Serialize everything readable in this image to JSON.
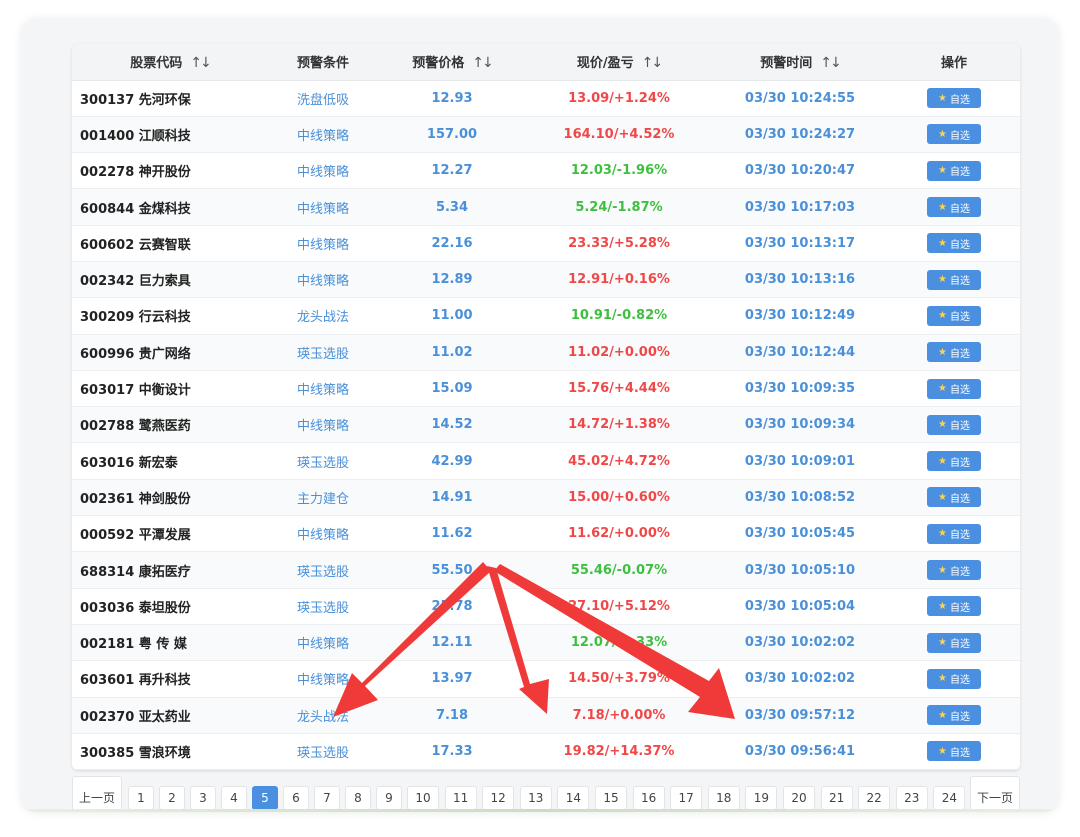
{
  "table": {
    "headers": {
      "code": "股票代码",
      "condition": "预警条件",
      "alert_price": "预警价格",
      "now_pl": "现价/盈亏",
      "alert_time": "预警时间",
      "action": "操作"
    },
    "sort_glyph": "↑↓",
    "button_label": "自选",
    "rows": [
      {
        "name": "300137 先河环保",
        "cond": "洗盘低吸",
        "price": "12.93",
        "now": "13.09/+1.24%",
        "dir": "up",
        "time": "03/30 10:24:55"
      },
      {
        "name": "001400 江顺科技",
        "cond": "中线策略",
        "price": "157.00",
        "now": "164.10/+4.52%",
        "dir": "up",
        "time": "03/30 10:24:27"
      },
      {
        "name": "002278 神开股份",
        "cond": "中线策略",
        "price": "12.27",
        "now": "12.03/-1.96%",
        "dir": "down",
        "time": "03/30 10:20:47"
      },
      {
        "name": "600844 金煤科技",
        "cond": "中线策略",
        "price": "5.34",
        "now": "5.24/-1.87%",
        "dir": "down",
        "time": "03/30 10:17:03"
      },
      {
        "name": "600602 云赛智联",
        "cond": "中线策略",
        "price": "22.16",
        "now": "23.33/+5.28%",
        "dir": "up",
        "time": "03/30 10:13:17"
      },
      {
        "name": "002342 巨力索具",
        "cond": "中线策略",
        "price": "12.89",
        "now": "12.91/+0.16%",
        "dir": "up",
        "time": "03/30 10:13:16"
      },
      {
        "name": "300209 行云科技",
        "cond": "龙头战法",
        "price": "11.00",
        "now": "10.91/-0.82%",
        "dir": "down",
        "time": "03/30 10:12:49"
      },
      {
        "name": "600996 贵广网络",
        "cond": "瑛玉选股",
        "price": "11.02",
        "now": "11.02/+0.00%",
        "dir": "up",
        "time": "03/30 10:12:44"
      },
      {
        "name": "603017 中衡设计",
        "cond": "中线策略",
        "price": "15.09",
        "now": "15.76/+4.44%",
        "dir": "up",
        "time": "03/30 10:09:35"
      },
      {
        "name": "002788 鹭燕医药",
        "cond": "中线策略",
        "price": "14.52",
        "now": "14.72/+1.38%",
        "dir": "up",
        "time": "03/30 10:09:34"
      },
      {
        "name": "603016 新宏泰",
        "cond": "瑛玉选股",
        "price": "42.99",
        "now": "45.02/+4.72%",
        "dir": "up",
        "time": "03/30 10:09:01"
      },
      {
        "name": "002361 神剑股份",
        "cond": "主力建仓",
        "price": "14.91",
        "now": "15.00/+0.60%",
        "dir": "up",
        "time": "03/30 10:08:52"
      },
      {
        "name": "000592 平潭发展",
        "cond": "中线策略",
        "price": "11.62",
        "now": "11.62/+0.00%",
        "dir": "up",
        "time": "03/30 10:05:45"
      },
      {
        "name": "688314 康拓医疗",
        "cond": "瑛玉选股",
        "price": "55.50",
        "now": "55.46/-0.07%",
        "dir": "down",
        "time": "03/30 10:05:10"
      },
      {
        "name": "003036 泰坦股份",
        "cond": "瑛玉选股",
        "price": "25.78",
        "now": "27.10/+5.12%",
        "dir": "up",
        "time": "03/30 10:05:04"
      },
      {
        "name": "002181 粤 传 媒",
        "cond": "中线策略",
        "price": "12.11",
        "now": "12.07/-0.33%",
        "dir": "down",
        "time": "03/30 10:02:02"
      },
      {
        "name": "603601 再升科技",
        "cond": "中线策略",
        "price": "13.97",
        "now": "14.50/+3.79%",
        "dir": "up",
        "time": "03/30 10:02:02"
      },
      {
        "name": "002370 亚太药业",
        "cond": "龙头战法",
        "price": "7.18",
        "now": "7.18/+0.00%",
        "dir": "up",
        "time": "03/30 09:57:12"
      },
      {
        "name": "300385 雪浪环境",
        "cond": "瑛玉选股",
        "price": "17.33",
        "now": "19.82/+14.37%",
        "dir": "up",
        "time": "03/30 09:56:41"
      }
    ]
  },
  "pagination": {
    "prev_label": "上一页",
    "next_label": "下一页",
    "pages": [
      "1",
      "2",
      "3",
      "4",
      "5",
      "6",
      "7",
      "8",
      "9",
      "10",
      "11",
      "12",
      "13",
      "14",
      "15",
      "16",
      "17",
      "18",
      "19",
      "20",
      "21",
      "22",
      "23",
      "24"
    ],
    "current": "5"
  },
  "colors": {
    "accent_blue": "#4a90d9",
    "up_red": "#f04848",
    "down_green": "#3fbf3f",
    "annotation_arrow": "#f03a3a"
  },
  "icons": {
    "button_icon": "star-icon",
    "annotation": "red-arrow-icon"
  }
}
